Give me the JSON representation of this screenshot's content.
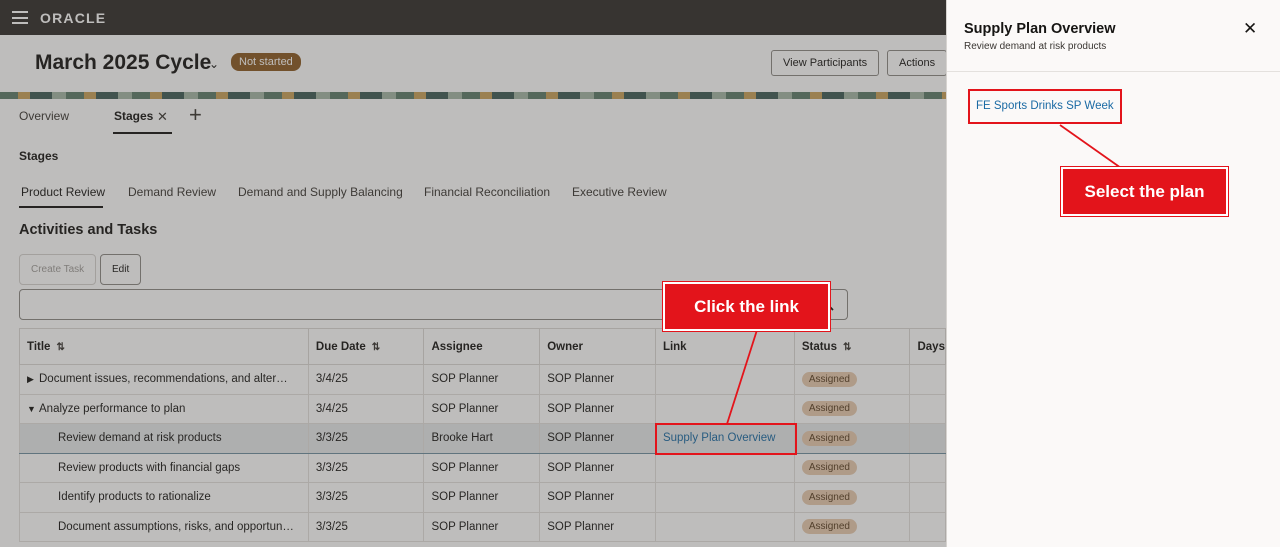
{
  "topbar": {
    "logo": "ORACLE"
  },
  "header": {
    "title": "March 2025 Cycle",
    "status_badge": "Not started",
    "view_participants": "View Participants",
    "actions": "Actions"
  },
  "tabs": [
    {
      "label": "Overview"
    },
    {
      "label": "Stages"
    }
  ],
  "stages_heading": "Stages",
  "stage_tabs": [
    "Product Review",
    "Demand Review",
    "Demand and Supply Balancing",
    "Financial Reconciliation",
    "Executive Review"
  ],
  "activities_heading": "Activities and Tasks",
  "buttons": {
    "create_task": "Create Task",
    "edit": "Edit"
  },
  "table": {
    "headers": [
      "Title",
      "Due Date",
      "Assignee",
      "Owner",
      "Link",
      "Status",
      "Days"
    ],
    "rows": [
      {
        "title": "Document issues, recommendations, and alter…",
        "due": "3/4/25",
        "assignee": "SOP Planner",
        "owner": "SOP Planner",
        "link": "",
        "status": "Assigned"
      },
      {
        "title": "Analyze performance to plan",
        "due": "3/4/25",
        "assignee": "SOP Planner",
        "owner": "SOP Planner",
        "link": "",
        "status": "Assigned"
      },
      {
        "title": "Review demand at risk products",
        "due": "3/3/25",
        "assignee": "Brooke Hart",
        "owner": "SOP Planner",
        "link": "Supply Plan Overview",
        "status": "Assigned"
      },
      {
        "title": "Review products with financial gaps",
        "due": "3/3/25",
        "assignee": "SOP Planner",
        "owner": "SOP Planner",
        "link": "",
        "status": "Assigned"
      },
      {
        "title": "Identify products to rationalize",
        "due": "3/3/25",
        "assignee": "SOP Planner",
        "owner": "SOP Planner",
        "link": "",
        "status": "Assigned"
      },
      {
        "title": "Document assumptions, risks, and opportun…",
        "due": "3/3/25",
        "assignee": "SOP Planner",
        "owner": "SOP Planner",
        "link": "",
        "status": "Assigned"
      }
    ]
  },
  "drawer": {
    "title": "Supply Plan Overview",
    "subtitle": "Review demand at risk products",
    "plan_link": "FE Sports Drinks SP Week"
  },
  "callouts": {
    "click_link": "Click the link",
    "select_plan": "Select the plan"
  },
  "colors": {
    "callout_red": "#e3141b",
    "link_blue": "#1a6aa4",
    "topbar": "#312d2a"
  }
}
